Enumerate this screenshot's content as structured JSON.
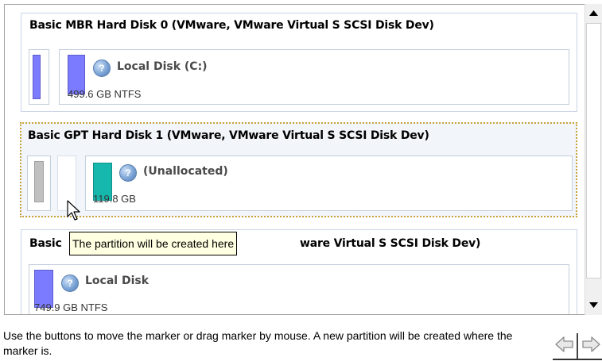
{
  "disks": [
    {
      "title": "Basic MBR Hard Disk 0 (VMware, VMware Virtual S SCSI Disk Dev)",
      "partitions": [
        {
          "name": "Local Disk (C:)",
          "size": "499.6 GB NTFS"
        }
      ]
    },
    {
      "title": "Basic GPT Hard Disk 1 (VMware, VMware Virtual S SCSI Disk Dev)",
      "partitions": [
        {
          "name": "(Unallocated)",
          "size": "119.8 GB"
        }
      ]
    },
    {
      "title_left": "Basic",
      "title_right": "ware Virtual S SCSI Disk Dev)",
      "partitions": [
        {
          "name": "Local Disk",
          "size": "749.9 GB NTFS"
        }
      ]
    }
  ],
  "tooltip": "The partition will be created here",
  "instruction": "Use the buttons to move the marker or drag marker by mouse. A new partition will be created where the marker is.",
  "icons": {
    "partition": "help-circle-icon",
    "scroll_up": "arrow-up-icon",
    "scroll_down": "arrow-down-icon",
    "move_left": "arrow-left-icon",
    "move_right": "arrow-right-icon",
    "cursor": "mouse-pointer-icon"
  },
  "colors": {
    "ntfs_bar": "#7b7bff",
    "unallocated_bar": "#16b8ad",
    "reserved_bar": "#c0c0c0",
    "selected_border": "#c9a33a",
    "tooltip_bg": "#ffffe1"
  }
}
